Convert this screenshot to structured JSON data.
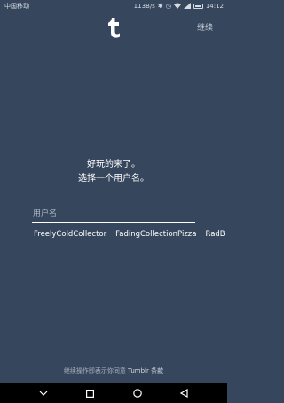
{
  "status_bar": {
    "carrier": "中国移动",
    "speed": "113B/s",
    "battery_level": "80",
    "time": "14:12"
  },
  "header": {
    "logo_icon": "tumblr-logo-icon",
    "continue_label": "继续"
  },
  "prompt": {
    "line1": "好玩的来了。",
    "line2": "选择一个用户名。"
  },
  "username": {
    "placeholder": "用户名",
    "value": ""
  },
  "suggestions": [
    "FreelyColdCollector",
    "FadingCollectionPizza",
    "RadB"
  ],
  "terms": {
    "prefix": "继续操作即表示你同意 ",
    "link": "Tumblr 条款"
  },
  "nav_bar": {
    "icons": [
      "chevron-down-icon",
      "square-icon",
      "circle-icon",
      "triangle-back-icon"
    ]
  },
  "colors": {
    "background": "#36465d",
    "text": "#ffffff"
  }
}
